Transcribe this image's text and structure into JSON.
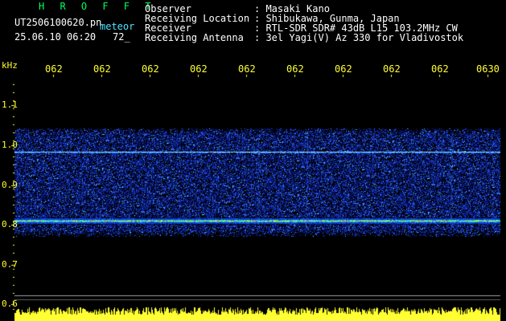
{
  "header": {
    "title": "H R O F F T",
    "filename": "UT2506100620.pn",
    "tag": "meteor",
    "datetime": "25.06.10 06:20",
    "count": "72_"
  },
  "station": [
    {
      "key": "Observer",
      "value": ": Masaki Kano"
    },
    {
      "key": "Receiving Location",
      "value": ": Shibukawa, Gunma, Japan"
    },
    {
      "key": "Receiver",
      "value": ": RTL-SDR SDR# 43dB L15 103.2MHz CW"
    },
    {
      "key": "Receiving Antenna",
      "value": ": 3el Yagi(V) Az 330 for Vladivostok"
    }
  ],
  "axis": {
    "unit": "kHz",
    "y_ticks": [
      "1.1",
      "1.0",
      "0.9",
      "0.8",
      "0.7",
      "0.6"
    ],
    "x_ticks": [
      "062",
      "062",
      "062",
      "062",
      "062",
      "062",
      "062",
      "062",
      "062",
      "0630"
    ]
  },
  "colors": {
    "header_green": "#00ff5a",
    "axis_yellow": "#ffff33",
    "info_white": "#ffffff",
    "meteor_cyan": "#4fe3ff",
    "noise_blue": "#1030c0"
  }
}
